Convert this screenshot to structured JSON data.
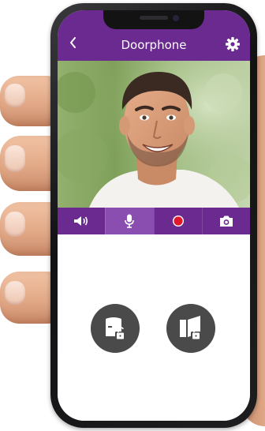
{
  "header": {
    "title": "Doorphone",
    "back_icon": "chevron-left-icon",
    "settings_icon": "gear-icon"
  },
  "video": {
    "content": "live-camera-feed"
  },
  "controls": [
    {
      "name": "speaker",
      "icon": "speaker-icon",
      "active": false
    },
    {
      "name": "microphone",
      "icon": "microphone-icon",
      "active": true
    },
    {
      "name": "record",
      "icon": "record-icon",
      "active": false
    },
    {
      "name": "snapshot",
      "icon": "camera-icon",
      "active": false
    }
  ],
  "actions": [
    {
      "name": "open-gate",
      "icon": "gate-unlock-icon"
    },
    {
      "name": "open-door",
      "icon": "door-unlock-icon"
    }
  ],
  "colors": {
    "brand_purple": "#6a2a8f",
    "active_tab": "#8a4db0",
    "record_red": "#e1182b",
    "action_button": "#4a4a4a"
  }
}
